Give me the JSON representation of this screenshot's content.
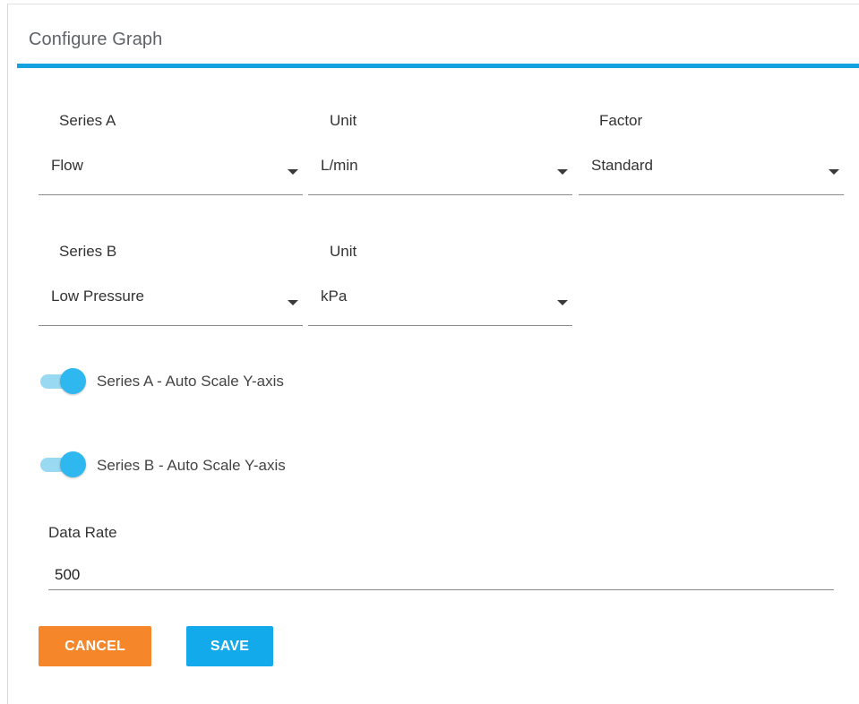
{
  "dialog": {
    "title": "Configure Graph"
  },
  "series_a": {
    "series_label": "Series A",
    "series_value": "Flow",
    "unit_label": "Unit",
    "unit_value": "L/min",
    "factor_label": "Factor",
    "factor_value": "Standard"
  },
  "series_b": {
    "series_label": "Series B",
    "series_value": "Low Pressure",
    "unit_label": "Unit",
    "unit_value": "kPa"
  },
  "toggles": {
    "series_a_autoscale_label": "Series A - Auto Scale Y-axis",
    "series_a_autoscale_on": true,
    "series_b_autoscale_label": "Series B - Auto Scale Y-axis",
    "series_b_autoscale_on": true
  },
  "data_rate": {
    "label": "Data Rate",
    "value": "500"
  },
  "actions": {
    "cancel_label": "CANCEL",
    "save_label": "SAVE"
  },
  "colors": {
    "accent": "#14a3e0",
    "cancel_button": "#f5862a",
    "save_button": "#12aaea",
    "toggle_track": "#9ad9f2",
    "toggle_thumb": "#2fb8ef"
  },
  "icons": {
    "dropdown": "caret-down-icon"
  }
}
